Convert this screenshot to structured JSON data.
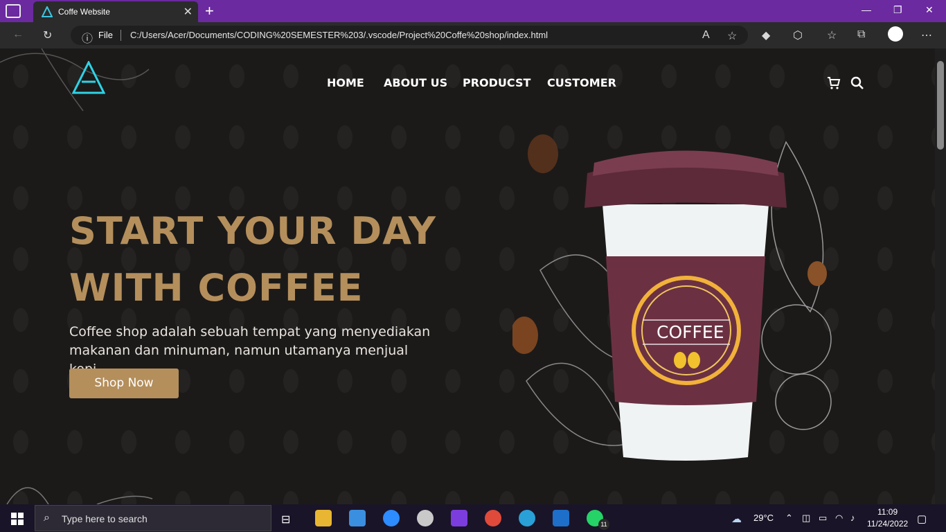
{
  "browser": {
    "tab_title": "Coffe Website",
    "file_label": "File",
    "url": "C:/Users/Acer/Documents/CODING%20SEMESTER%203/.vscode/Project%20Coffe%20shop/index.html"
  },
  "nav": {
    "items": [
      "HOME",
      "ABOUT US",
      "PRODUCST",
      "CUSTOMER"
    ]
  },
  "hero": {
    "line1": "START YOUR DAY",
    "line2": "WITH COFFEE",
    "desc": "Coffee shop adalah sebuah tempat yang menyediakan makanan dan minuman, namun utamanya menjual kopi.",
    "button": "Shop Now",
    "cup_label": "COFFEE"
  },
  "taskbar": {
    "search_placeholder": "Type here to search",
    "weather": "29°C",
    "time": "11:09",
    "date": "11/24/2022",
    "whatsapp_badge": "11"
  },
  "colors": {
    "accent": "#b48f5c",
    "titlebar": "#6b2aa0",
    "page_bg": "#1c1a19"
  }
}
